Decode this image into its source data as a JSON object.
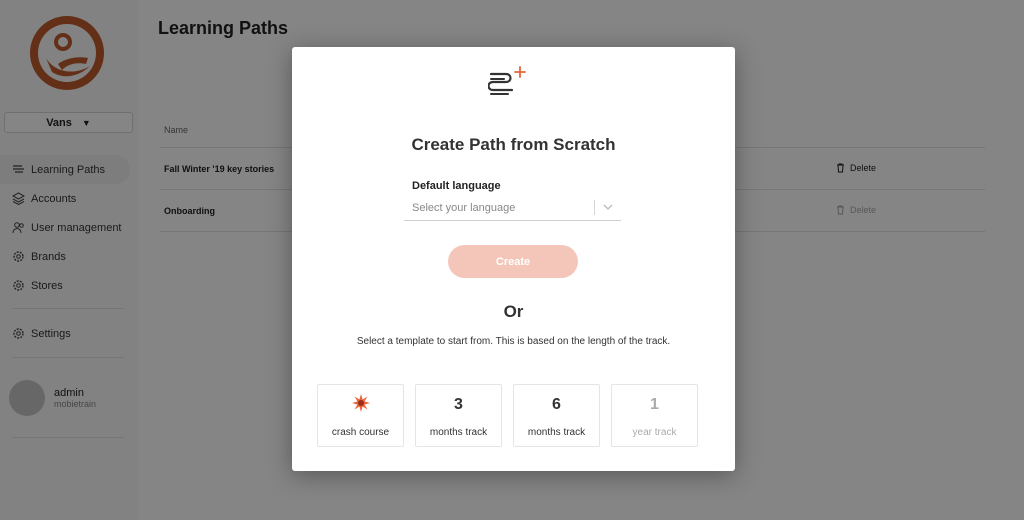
{
  "app": {
    "brand_selector": "Vans",
    "page_title": "Learning Paths"
  },
  "sidebar": {
    "items": [
      {
        "label": "Learning Paths",
        "icon": "paths-icon"
      },
      {
        "label": "Accounts",
        "icon": "layers-icon"
      },
      {
        "label": "User management",
        "icon": "users-icon"
      },
      {
        "label": "Brands",
        "icon": "gear-icon"
      },
      {
        "label": "Stores",
        "icon": "gear-icon"
      }
    ],
    "settings_label": "Settings",
    "user": {
      "name": "admin",
      "org": "mobietrain"
    }
  },
  "table": {
    "column_name": "Name",
    "rows": [
      {
        "name": "Fall Winter '19 key stories",
        "action": "Delete",
        "enabled": true
      },
      {
        "name": "Onboarding",
        "action": "Delete",
        "enabled": false
      }
    ]
  },
  "modal": {
    "title": "Create Path from Scratch",
    "language_label": "Default language",
    "language_placeholder": "Select your language",
    "create_label": "Create",
    "or_label": "Or",
    "helper_text": "Select a template to start from. This is based on the length of the track.",
    "templates": [
      {
        "number": "",
        "label": "crash course",
        "icon": "burst-icon",
        "enabled": true
      },
      {
        "number": "3",
        "label": "months track",
        "enabled": true
      },
      {
        "number": "6",
        "label": "months track",
        "enabled": true
      },
      {
        "number": "1",
        "label": "year track",
        "enabled": false
      }
    ]
  },
  "colors": {
    "accent": "#e8643c",
    "logo": "#c05a2c",
    "create_button": "#f4c6b9",
    "overlay": "rgba(0,0,0,0.48)"
  }
}
